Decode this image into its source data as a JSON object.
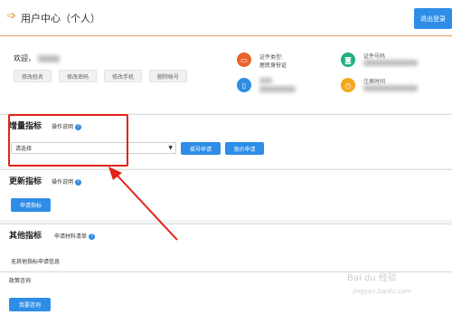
{
  "header": {
    "title": "用户中心（个人）",
    "logout_label": "退出登录"
  },
  "profile": {
    "welcome": "欢迎，",
    "buttons": [
      "修改姓名",
      "修改密码",
      "修改手机",
      "删除帐号"
    ],
    "info": [
      {
        "label": "证件类型:",
        "value": "居民身份证"
      },
      {
        "label": "证件号码",
        "value": ""
      },
      {
        "label": "",
        "value": ""
      },
      {
        "label": "注册时间",
        "value": ""
      }
    ]
  },
  "increase": {
    "title": "增量指标",
    "help_label": "操作说明",
    "select_value": "请选择",
    "btn_lottery": "摇号申请",
    "btn_bid": "竞价申请"
  },
  "update": {
    "title": "更新指标",
    "help_label": "操作说明",
    "btn_apply": "申请指标"
  },
  "other": {
    "title": "其他指标",
    "help_label": "申请材料清单",
    "empty_text": "无其他指标申请信息"
  },
  "policy": {
    "label": "政策咨询",
    "btn_consult": "我要咨询"
  },
  "watermark": {
    "brand": "Bai du 经验",
    "url": "jingyan.baidu.com"
  },
  "colors": {
    "accent_orange": "#e57f17",
    "primary_blue": "#2e8de6",
    "highlight_red": "#e32219"
  }
}
